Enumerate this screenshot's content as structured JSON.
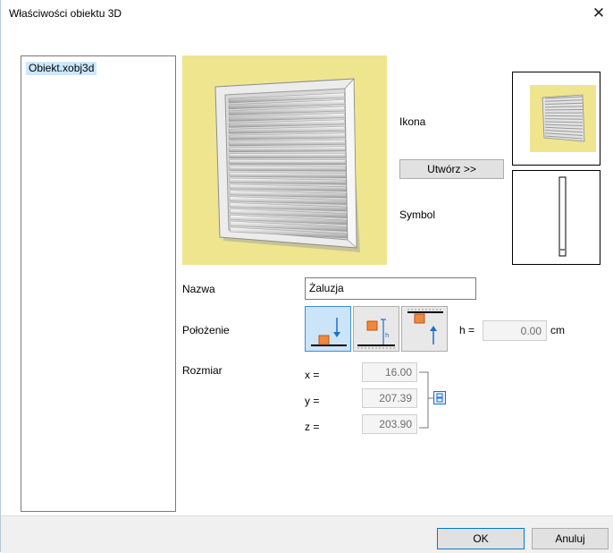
{
  "window": {
    "title": "Właściwości obiektu 3D",
    "close_glyph": "✕"
  },
  "file_list": {
    "items": [
      "Obiekt.xobj3d"
    ]
  },
  "preview": {
    "background": "#efe58f"
  },
  "labels": {
    "icon": "Ikona",
    "symbol": "Symbol",
    "name": "Nazwa",
    "position": "Położenie",
    "size": "Rozmiar",
    "h": "h =",
    "h_unit": "cm",
    "x": "x =",
    "y": "y =",
    "z": "z ="
  },
  "buttons": {
    "create": "Utwórz >>",
    "ok": "OK",
    "cancel": "Anuluj"
  },
  "fields": {
    "name": "Żaluzja",
    "h": "0.00",
    "x": "16.00",
    "y": "207.39",
    "z": "203.90"
  },
  "position_options": [
    {
      "name": "floor-aligned",
      "icon": "floor-position-icon",
      "selected": true
    },
    {
      "name": "height-offset",
      "icon": "height-position-icon",
      "selected": false
    },
    {
      "name": "ceiling-aligned",
      "icon": "ceiling-position-icon",
      "selected": false
    }
  ],
  "colors": {
    "accent": "#0078d7",
    "selected_bg": "#cce4f7",
    "marker": "#f0883e"
  }
}
